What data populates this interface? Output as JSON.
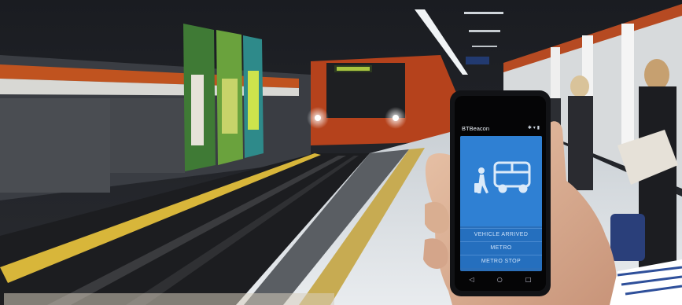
{
  "app": {
    "title": "BTBeacon"
  },
  "status_bar": {
    "icons": "✱ ▾ ▮"
  },
  "buttons": {
    "vehicle_arrived": "VEHICLE ARRIVED",
    "metro": "METRO",
    "metro_stop": "METRO STOP"
  },
  "nav": {
    "back": "◁",
    "home": "○",
    "recents": "□"
  },
  "icons": {
    "pedestrian": "walking-person-icon",
    "vehicle": "bus-icon"
  },
  "colors": {
    "screen": "#2f80d3",
    "button": "#256fbe",
    "train": "#c0471f",
    "platform_stripe": "#d9b83a"
  }
}
